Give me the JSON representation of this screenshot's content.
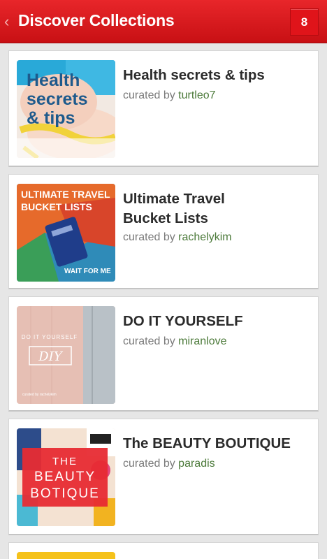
{
  "header": {
    "title": "Discover Collections",
    "badge": "8",
    "back_icon": "chevron-left-icon"
  },
  "curated_prefix": "curated by",
  "collections": [
    {
      "title": "Health secrets & tips",
      "curator": "turtleo7",
      "thumb_text": [
        "Health",
        "secrets",
        "& tips"
      ]
    },
    {
      "title": "Ultimate Travel Bucket Lists",
      "curator": "rachelykim",
      "thumb_text": [
        "ULTIMATE TRAVEL",
        "BUCKET LISTS",
        "WAIT FOR ME"
      ]
    },
    {
      "title": "DO IT YOURSELF",
      "curator": "miranlove",
      "thumb_text": [
        "DO IT YOURSELF",
        "DIY",
        "curated by rachelykim"
      ]
    },
    {
      "title": "The BEAUTY BOUTIQUE",
      "curator": "paradis",
      "thumb_text": [
        "THE",
        "BEAUTY",
        "BOTIQUE"
      ]
    }
  ],
  "colors": {
    "header_red": "#d61a1e",
    "curator_green": "#4c7a3a",
    "background": "#e6e6e6"
  }
}
